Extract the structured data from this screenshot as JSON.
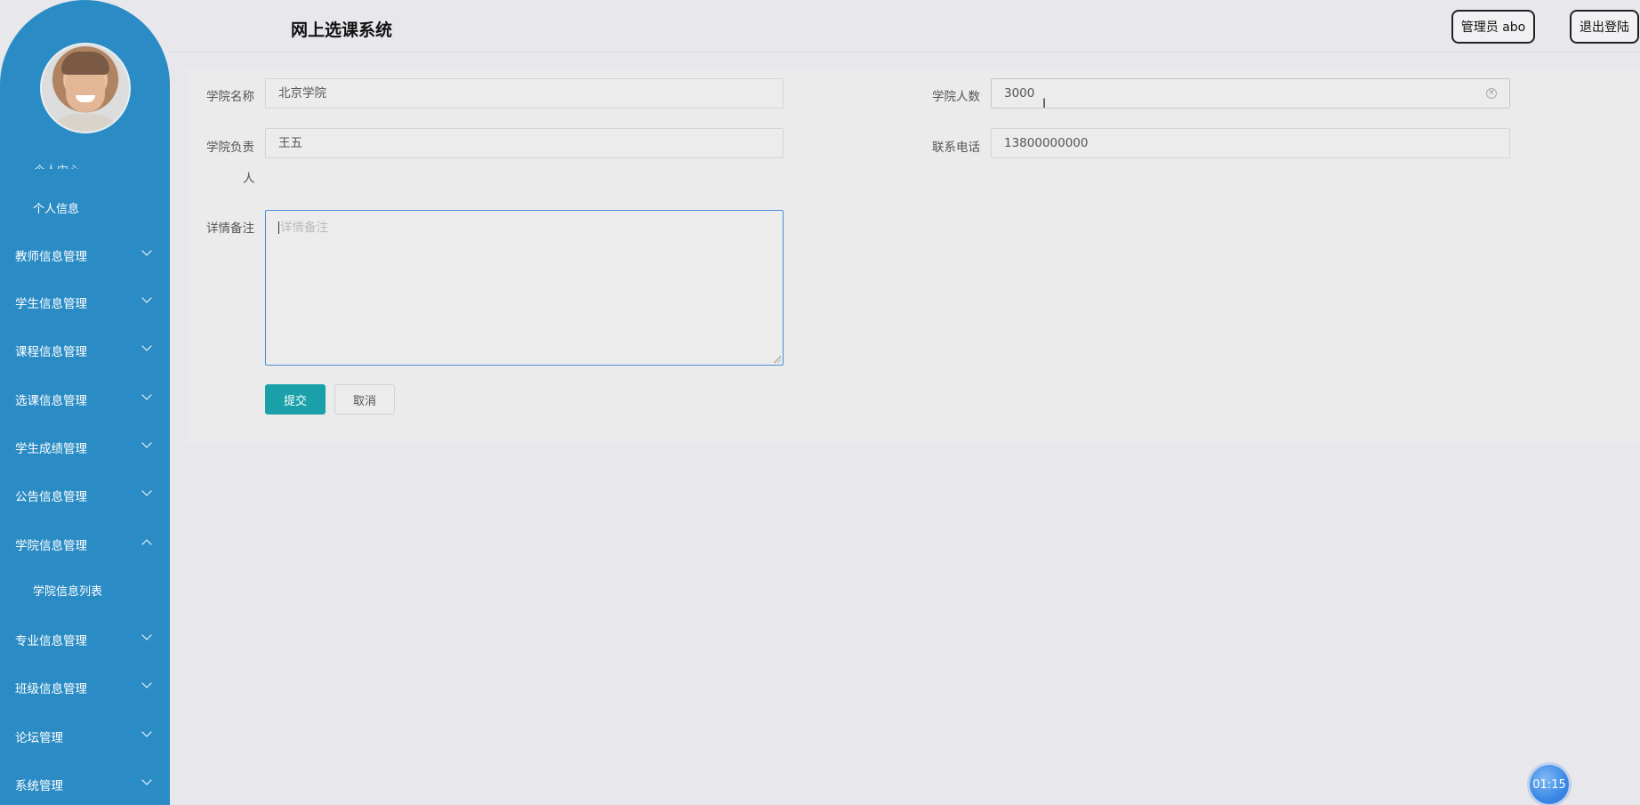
{
  "header": {
    "title": "网上选课系统",
    "admin_label": "管理员 abo",
    "logout_label": "退出登陆"
  },
  "sidebar": {
    "clipped_text": "个人中心",
    "sub_profile": "个人信息",
    "items": [
      {
        "label": "教师信息管理",
        "expanded": false
      },
      {
        "label": "学生信息管理",
        "expanded": false
      },
      {
        "label": "课程信息管理",
        "expanded": false
      },
      {
        "label": "选课信息管理",
        "expanded": false
      },
      {
        "label": "学生成绩管理",
        "expanded": false
      },
      {
        "label": "公告信息管理",
        "expanded": false
      },
      {
        "label": "学院信息管理",
        "expanded": true
      },
      {
        "label": "专业信息管理",
        "expanded": false
      },
      {
        "label": "班级信息管理",
        "expanded": false
      },
      {
        "label": "论坛管理",
        "expanded": false
      },
      {
        "label": "系统管理",
        "expanded": false
      }
    ],
    "college_sub": "学院信息列表"
  },
  "form": {
    "college_name_label": "学院名称",
    "college_name_value": "北京学院",
    "college_count_label": "学院人数",
    "college_count_value": "3000",
    "leader_label_line1": "学院负责",
    "leader_label_line2": "人",
    "leader_value": "王五",
    "phone_label": "联系电话",
    "phone_value": "13800000000",
    "remark_label": "详情备注",
    "remark_placeholder": "详情备注",
    "submit_label": "提交",
    "cancel_label": "取消"
  },
  "timer": "01:15",
  "colors": {
    "sidebar": "#2b8cc5",
    "primary_button": "#1aa0a8",
    "focus_border": "#4a8fd8"
  }
}
